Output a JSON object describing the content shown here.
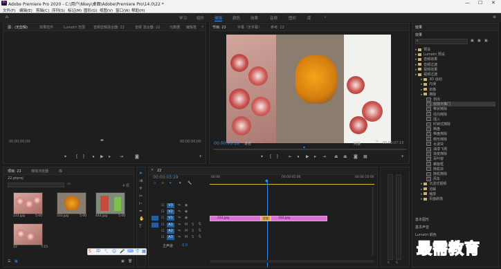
{
  "app": {
    "title": "Adobe Premiere Pro 2020 - C:\\用户\\Nkey\\桌面\\Adobe\\Premiere Pro\\14.0\\22 *",
    "window_controls": [
      "—",
      "☐",
      "✕"
    ]
  },
  "menu": [
    "文件(F)",
    "编辑(E)",
    "剪辑(C)",
    "序列(S)",
    "标记(M)",
    "图形(G)",
    "视图(V)",
    "窗口(W)",
    "帮助(H)"
  ],
  "workspaces": [
    "学习",
    "组件",
    "编辑",
    "颜色",
    "效果",
    "音频",
    "图形",
    "库"
  ],
  "source_panel": {
    "tabs": [
      "源：(无剪辑)",
      "效果控件",
      "Lumetri 范围",
      "音频剪辑混合器: 22",
      "音频 混合器: 22",
      "元数据",
      "编辑签"
    ],
    "tc_left": "00;00;00;00",
    "tc_right": "00;00;00;00"
  },
  "program_panel": {
    "tabs": [
      "节目: 22",
      "字幕（无字幕）",
      "参考: 22"
    ],
    "tc_current": "00:00:03:19",
    "fit_label": "适合",
    "quality_label": "完整",
    "tc_duration": "00:00:07:15"
  },
  "project_panel": {
    "tabs": [
      "项目: 22",
      "媒体浏览器",
      "库"
    ],
    "path": "22.prproj",
    "items": [
      {
        "name": "222.jpg",
        "dur": "5:00"
      },
      {
        "name": "333.jpg",
        "dur": "5:00"
      },
      {
        "name": "444.jpg",
        "dur": "5:00"
      },
      {
        "name": "22",
        "dur": "7:15"
      }
    ]
  },
  "timeline": {
    "tab": "22",
    "timecode": "00:00:03:19",
    "ruler": [
      "00:00",
      "00:00:05:00",
      "00:00:10:00"
    ],
    "video_tracks": [
      "V3",
      "V2",
      "V1"
    ],
    "audio_tracks": [
      "A1",
      "A2",
      "A3"
    ],
    "master_label": "主声道",
    "master_val": "0.0",
    "clips": [
      {
        "label": "222.jpg"
      },
      {
        "label": "交叉"
      },
      {
        "label": "333.jpg"
      }
    ]
  },
  "effects_panel": {
    "tabs": [
      "效果"
    ],
    "header": "效果",
    "items": [
      {
        "label": "预设",
        "depth": 0,
        "kind": "folder"
      },
      {
        "label": "Lumetri 预设",
        "depth": 0,
        "kind": "folder"
      },
      {
        "label": "音频效果",
        "depth": 0,
        "kind": "folder"
      },
      {
        "label": "音频过渡",
        "depth": 0,
        "kind": "folder"
      },
      {
        "label": "视频效果",
        "depth": 0,
        "kind": "folder"
      },
      {
        "label": "视频过渡",
        "depth": 0,
        "kind": "folder"
      },
      {
        "label": "3D 运动",
        "depth": 1,
        "kind": "folder"
      },
      {
        "label": "内滑",
        "depth": 1,
        "kind": "folder"
      },
      {
        "label": "划像",
        "depth": 1,
        "kind": "folder"
      },
      {
        "label": "擦除",
        "depth": 1,
        "kind": "folder"
      },
      {
        "label": "划出",
        "depth": 2,
        "kind": "fx"
      },
      {
        "label": "双侧平推门",
        "depth": 2,
        "kind": "fx",
        "selected": true
      },
      {
        "label": "带状擦除",
        "depth": 2,
        "kind": "fx"
      },
      {
        "label": "径向擦除",
        "depth": 2,
        "kind": "fx"
      },
      {
        "label": "插入",
        "depth": 2,
        "kind": "fx"
      },
      {
        "label": "时钟式擦除",
        "depth": 2,
        "kind": "fx"
      },
      {
        "label": "棋盘",
        "depth": 2,
        "kind": "fx"
      },
      {
        "label": "棋盘擦除",
        "depth": 2,
        "kind": "fx"
      },
      {
        "label": "楔形擦除",
        "depth": 2,
        "kind": "fx"
      },
      {
        "label": "水波块",
        "depth": 2,
        "kind": "fx"
      },
      {
        "label": "油漆飞溅",
        "depth": 2,
        "kind": "fx"
      },
      {
        "label": "渐变擦除",
        "depth": 2,
        "kind": "fx"
      },
      {
        "label": "百叶窗",
        "depth": 2,
        "kind": "fx"
      },
      {
        "label": "螺旋框",
        "depth": 2,
        "kind": "fx"
      },
      {
        "label": "随机块",
        "depth": 2,
        "kind": "fx"
      },
      {
        "label": "随机擦除",
        "depth": 2,
        "kind": "fx"
      },
      {
        "label": "风车",
        "depth": 2,
        "kind": "fx"
      },
      {
        "label": "沉浸式视频",
        "depth": 1,
        "kind": "folder"
      },
      {
        "label": "溶解",
        "depth": 1,
        "kind": "folder"
      },
      {
        "label": "缩放",
        "depth": 1,
        "kind": "folder"
      },
      {
        "label": "页面剥落",
        "depth": 1,
        "kind": "folder"
      }
    ],
    "sub_panels": [
      "基本图形",
      "基本声音",
      "Lumetri 颜色"
    ]
  },
  "watermark": "最需教育",
  "colors": {
    "accent": "#2d8ceb",
    "clip": "#d873d4",
    "selected_row": "#3a3a3a"
  }
}
